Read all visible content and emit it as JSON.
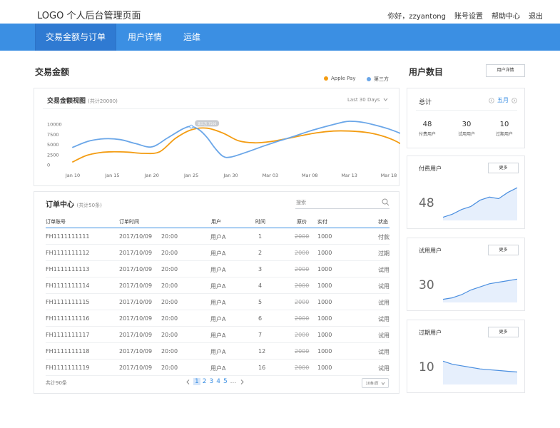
{
  "topbar": {
    "logo": "LOGO   个人后台管理页面",
    "links": [
      "你好，zzyantong",
      "账号设置",
      "帮助中心",
      "退出"
    ]
  },
  "nav": {
    "items": [
      "交易金额与订单",
      "用户详情",
      "运维"
    ],
    "active": 0
  },
  "trade": {
    "section_title": "交易金额",
    "legend": [
      {
        "name": "Apple Pay",
        "color": "#f39c12"
      },
      {
        "name": "第三方",
        "color": "#6aa6e8"
      }
    ],
    "chart_title": "交易金额视图",
    "chart_subtitle": "(共计20000)",
    "range_label": "Last 30 Days",
    "tooltip": "第三方 7500"
  },
  "chart_data": {
    "type": "line",
    "categories": [
      "Jan 10",
      "Jan 15",
      "Jan 20",
      "Jan 25",
      "Jan 30",
      "Mar 03",
      "Mar 08",
      "Mar 13",
      "Mar 18"
    ],
    "y_ticks": [
      10000,
      7500,
      5000,
      2500,
      0
    ],
    "ylim": [
      0,
      10000
    ],
    "series": [
      {
        "name": "Apple Pay",
        "color": "#f39c12",
        "x": [
          0,
          0.35,
          0.7,
          1.0,
          1.4,
          1.8,
          2.2,
          2.6,
          3.0,
          3.4,
          3.8,
          4.2,
          4.6,
          5.0,
          5.4,
          5.8,
          6.2,
          6.6,
          7.0,
          7.4,
          7.8,
          8.2,
          8.6,
          9.0
        ],
        "values": [
          700,
          2300,
          3000,
          3200,
          3100,
          2800,
          3200,
          6500,
          8600,
          9000,
          7800,
          5900,
          5400,
          5700,
          6400,
          7200,
          7900,
          8300,
          8300,
          8000,
          7200,
          5700,
          3200,
          -200
        ]
      },
      {
        "name": "第三方",
        "color": "#6aa6e8",
        "x": [
          0,
          0.4,
          0.8,
          1.2,
          1.6,
          2.0,
          2.4,
          2.8,
          3.0,
          3.2,
          3.4,
          3.6,
          3.8,
          4.0,
          4.4,
          4.8,
          5.2,
          5.6,
          6.0,
          6.4,
          6.8,
          7.0,
          7.3,
          7.6,
          8.0,
          8.4,
          8.7,
          9.0
        ],
        "values": [
          4300,
          5800,
          6400,
          6200,
          5200,
          4400,
          6600,
          8900,
          9400,
          8600,
          6700,
          4100,
          2100,
          1900,
          3100,
          4500,
          5800,
          7000,
          8300,
          9400,
          10400,
          10700,
          10500,
          9900,
          8800,
          7300,
          5900,
          4400
        ]
      }
    ]
  },
  "orders": {
    "title": "订单中心",
    "subtitle": "(共计50条)",
    "search_placeholder": "搜索",
    "columns": [
      "订单账号",
      "订单时间",
      "用户",
      "时间",
      "原价",
      "实付",
      "状态"
    ],
    "rows": [
      [
        "FH1111111111",
        "2017/10/09",
        "20:00",
        "用户A",
        "1",
        "2000",
        "1000",
        "付款"
      ],
      [
        "FH1111111112",
        "2017/10/09",
        "20:00",
        "用户A",
        "2",
        "2000",
        "1000",
        "过期"
      ],
      [
        "FH1111111113",
        "2017/10/09",
        "20:00",
        "用户A",
        "3",
        "2000",
        "1000",
        "试用"
      ],
      [
        "FH1111111114",
        "2017/10/09",
        "20:00",
        "用户A",
        "4",
        "2000",
        "1000",
        "试用"
      ],
      [
        "FH1111111115",
        "2017/10/09",
        "20:00",
        "用户A",
        "5",
        "2000",
        "1000",
        "试用"
      ],
      [
        "FH1111111116",
        "2017/10/09",
        "20:00",
        "用户A",
        "6",
        "2000",
        "1000",
        "试用"
      ],
      [
        "FH1111111117",
        "2017/10/09",
        "20:00",
        "用户A",
        "7",
        "2000",
        "1000",
        "试用"
      ],
      [
        "FH1111111118",
        "2017/10/09",
        "20:00",
        "用户A",
        "12",
        "2000",
        "1000",
        "试用"
      ],
      [
        "FH1111111119",
        "2017/10/09",
        "20:00",
        "用户A",
        "16",
        "2000",
        "1000",
        "试用"
      ]
    ],
    "total_label": "共计90条",
    "pages": [
      "1",
      "2",
      "3",
      "4",
      "5",
      "..."
    ],
    "current_page": "1",
    "page_size": "10条/页"
  },
  "users": {
    "section_title": "用户数目",
    "detail_button": "用户详情",
    "summary": {
      "title": "总计",
      "month": "五月",
      "stats": [
        {
          "value": "48",
          "label": "付费用户"
        },
        {
          "value": "30",
          "label": "试用用户"
        },
        {
          "value": "10",
          "label": "过期用户"
        }
      ]
    },
    "more_label": "更多",
    "cards": [
      {
        "title": "付费用户",
        "value": "48",
        "trend": [
          2,
          4,
          7,
          9,
          13,
          15,
          14,
          18,
          21
        ]
      },
      {
        "title": "试用用户",
        "value": "30",
        "trend": [
          2,
          3,
          5,
          8,
          10,
          12,
          13,
          14,
          15
        ]
      },
      {
        "title": "过期用户",
        "value": "10",
        "trend": [
          15,
          13,
          12,
          11,
          10,
          9.5,
          9,
          8.5,
          8
        ]
      }
    ]
  }
}
